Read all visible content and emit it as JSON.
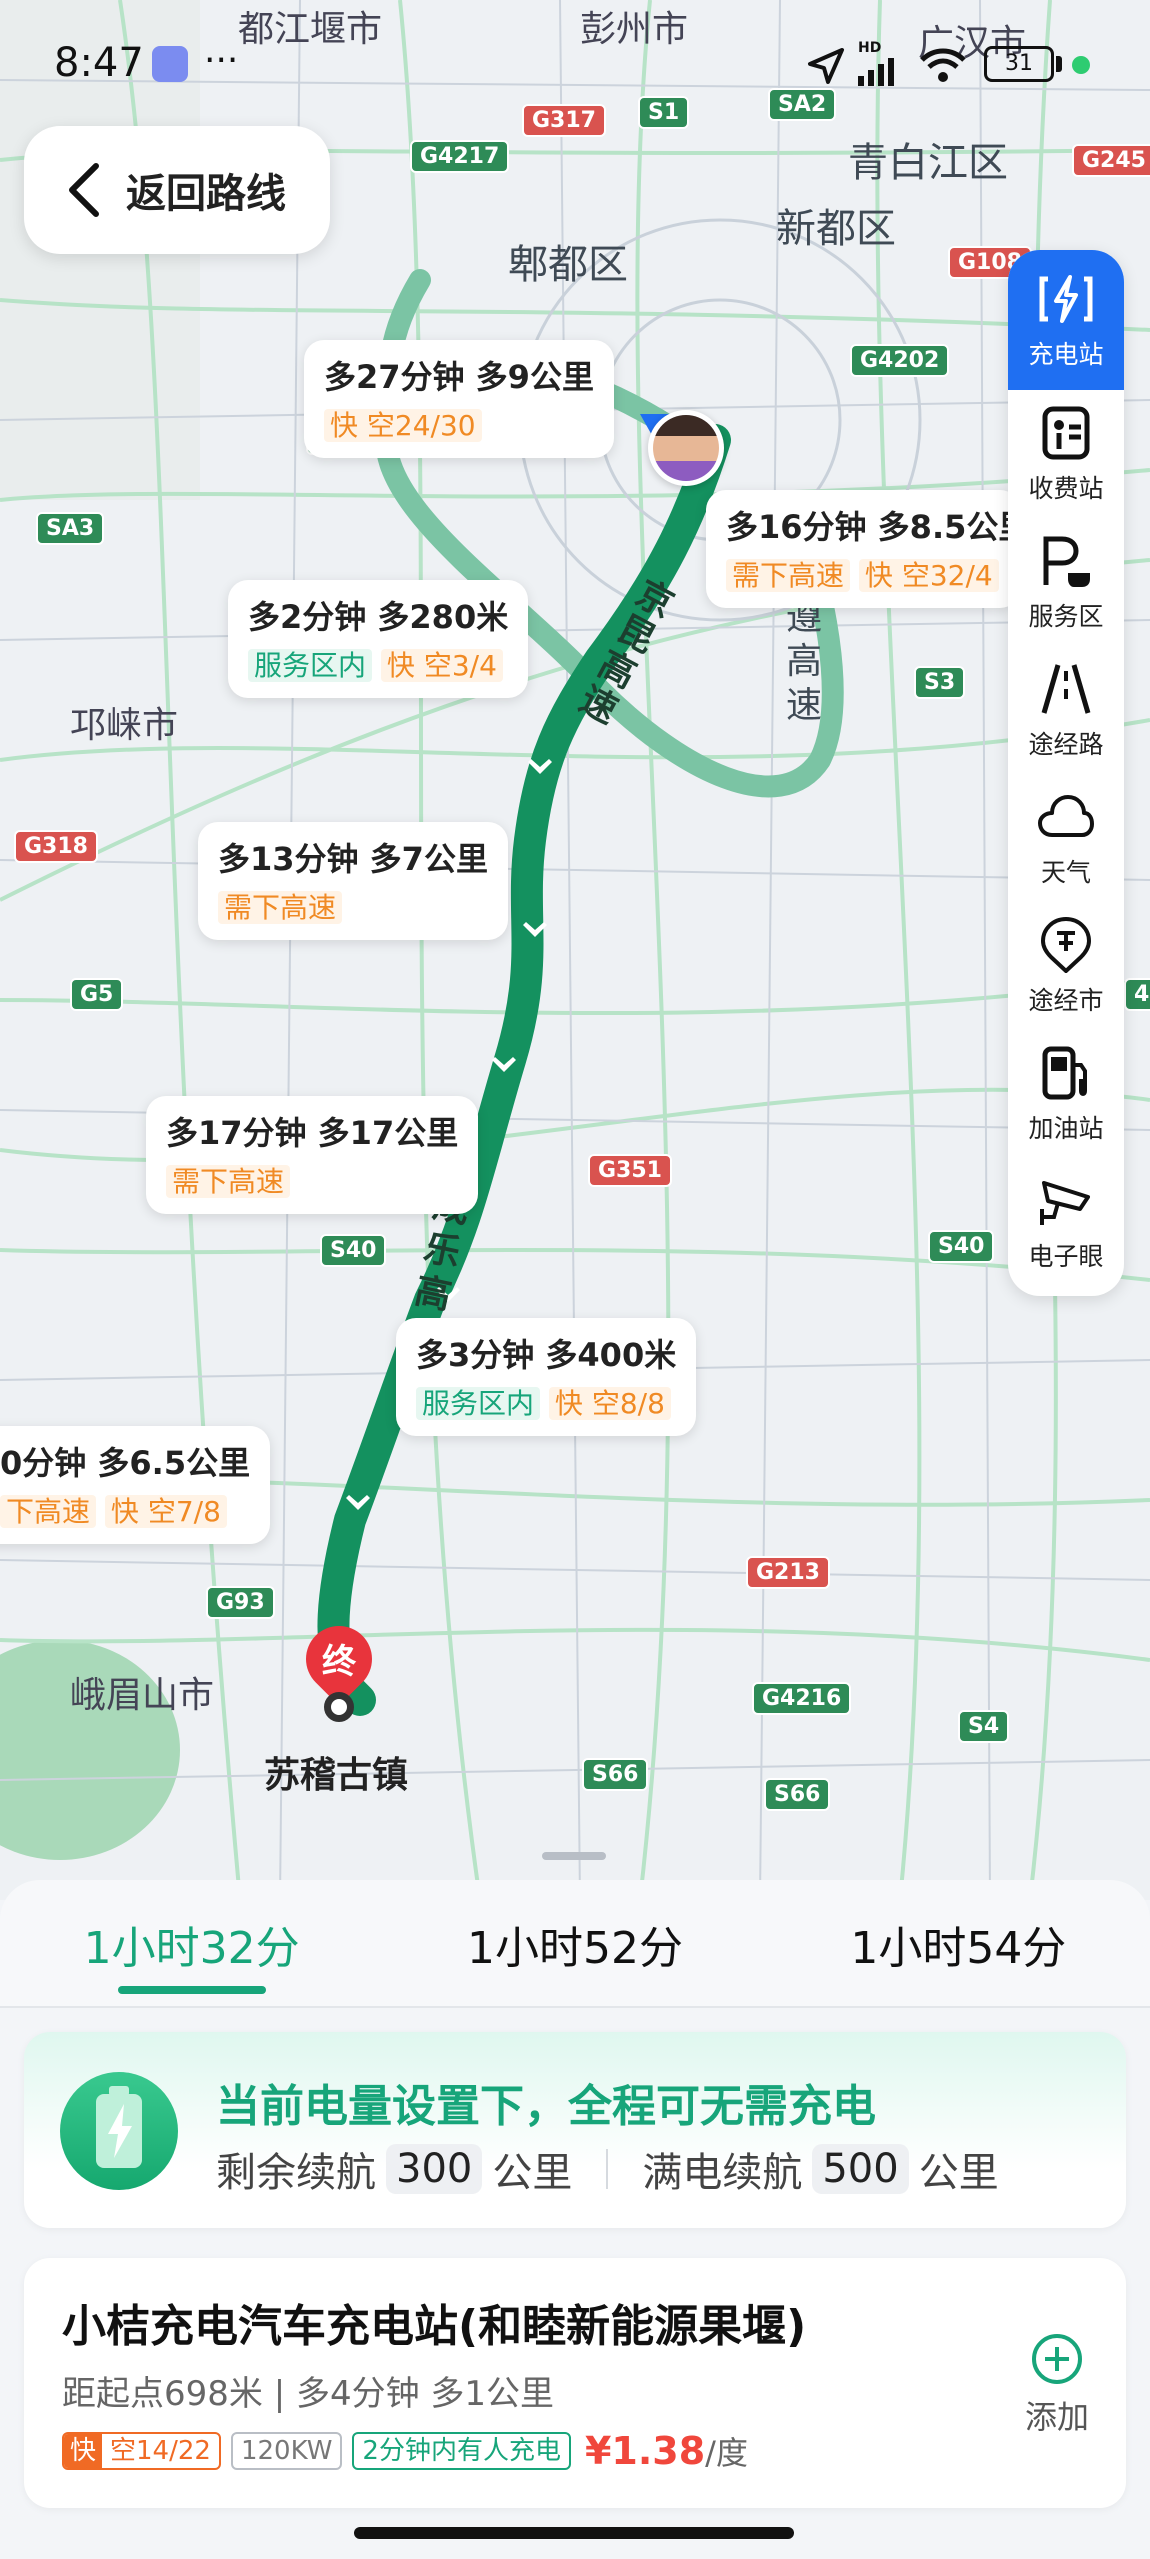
{
  "status_bar": {
    "time": "8:47",
    "more": "···",
    "network": "HD",
    "battery": "31"
  },
  "back": {
    "label": "返回路线"
  },
  "places": [
    {
      "name": "都江堰市"
    },
    {
      "name": "彭州市"
    },
    {
      "name": "广汉市"
    },
    {
      "name": "青白江区"
    },
    {
      "name": "新都区"
    },
    {
      "name": "郫都区"
    },
    {
      "name": "邛崃市"
    },
    {
      "name": "峨眉山市"
    },
    {
      "name": "苏稽古镇"
    }
  ],
  "road_shields": [
    {
      "label": "G317",
      "c": "r"
    },
    {
      "label": "S1",
      "c": "g"
    },
    {
      "label": "SA2",
      "c": "g"
    },
    {
      "label": "G245",
      "c": "r"
    },
    {
      "label": "G4217",
      "c": "g"
    },
    {
      "label": "G108",
      "c": "r"
    },
    {
      "label": "G4202",
      "c": "g"
    },
    {
      "label": "G5",
      "c": "g"
    },
    {
      "label": "SA3",
      "c": "g"
    },
    {
      "label": "S3",
      "c": "g"
    },
    {
      "label": "G318",
      "c": "r"
    },
    {
      "label": "G5",
      "c": "g"
    },
    {
      "label": "G351",
      "c": "r"
    },
    {
      "label": "S40",
      "c": "g"
    },
    {
      "label": "S40",
      "c": "g"
    },
    {
      "label": "G213",
      "c": "r"
    },
    {
      "label": "G93",
      "c": "g"
    },
    {
      "label": "G4216",
      "c": "g"
    },
    {
      "label": "S4",
      "c": "g"
    },
    {
      "label": "S66",
      "c": "g"
    },
    {
      "label": "S66",
      "c": "g"
    },
    {
      "label": "4",
      "c": "g"
    }
  ],
  "road_names": {
    "jingkun": [
      "京",
      "昆",
      "高",
      "速"
    ],
    "chengzun": [
      "遵",
      "高",
      "速"
    ],
    "chengle": [
      "成",
      "乐",
      "高"
    ]
  },
  "side_menu": [
    {
      "label": "充电站",
      "icon": "charging-station-icon"
    },
    {
      "label": "收费站",
      "icon": "toll-station-icon"
    },
    {
      "label": "服务区",
      "icon": "service-area-icon"
    },
    {
      "label": "途经路",
      "icon": "via-road-icon"
    },
    {
      "label": "天气",
      "icon": "weather-icon"
    },
    {
      "label": "途经市",
      "icon": "via-city-icon"
    },
    {
      "label": "加油站",
      "icon": "gas-station-icon"
    },
    {
      "label": "电子眼",
      "icon": "camera-icon"
    }
  ],
  "bubbles": [
    {
      "l1": "多27分钟 多9公里",
      "tags": [
        {
          "t": "快 空24/30",
          "k": "o"
        }
      ]
    },
    {
      "l1": "多16分钟 多8.5公里",
      "tags": [
        {
          "t": "需下高速",
          "k": "o"
        },
        {
          "t": "快 空32/4",
          "k": "o"
        }
      ]
    },
    {
      "l1": "多2分钟 多280米",
      "tags": [
        {
          "t": "服务区内",
          "k": "t"
        },
        {
          "t": "快 空3/4",
          "k": "o"
        }
      ]
    },
    {
      "l1": "多13分钟 多7公里",
      "tags": [
        {
          "t": "需下高速",
          "k": "o"
        }
      ]
    },
    {
      "l1": "多17分钟 多17公里",
      "tags": [
        {
          "t": "需下高速",
          "k": "o"
        }
      ]
    },
    {
      "l1": "多3分钟 多400米",
      "tags": [
        {
          "t": "服务区内",
          "k": "t"
        },
        {
          "t": "快 空8/8",
          "k": "o"
        }
      ]
    },
    {
      "l1": "0分钟 多6.5公里",
      "tags": [
        {
          "t": "下高速",
          "k": "o"
        },
        {
          "t": "快 空7/8",
          "k": "o"
        }
      ]
    }
  ],
  "end_marker": "终",
  "tabs": [
    {
      "label": "1小时32分",
      "active": true
    },
    {
      "label": "1小时52分",
      "active": false
    },
    {
      "label": "1小时54分",
      "active": false
    }
  ],
  "battery_card": {
    "headline": "当前电量设置下，全程可无需充电",
    "remain_label": "剩余续航",
    "remain_value": "300",
    "remain_unit": "公里",
    "full_label": "满电续航",
    "full_value": "500",
    "full_unit": "公里"
  },
  "station_card": {
    "name": "小桔充电汽车充电站(和睦新能源果堰)",
    "info": "距起点698米 | 多4分钟 多1公里",
    "fast": "快",
    "slots": "空14/22",
    "power": "120KW",
    "recent": "2分钟内有人充电",
    "price": "¥1.38",
    "price_unit": "/度",
    "add_label": "添加"
  },
  "colors": {
    "accent": "#17a57a",
    "route": "#14915f",
    "alt_route": "#7bc4a4",
    "blue": "#1f6ff2",
    "orange": "#f08a24"
  }
}
